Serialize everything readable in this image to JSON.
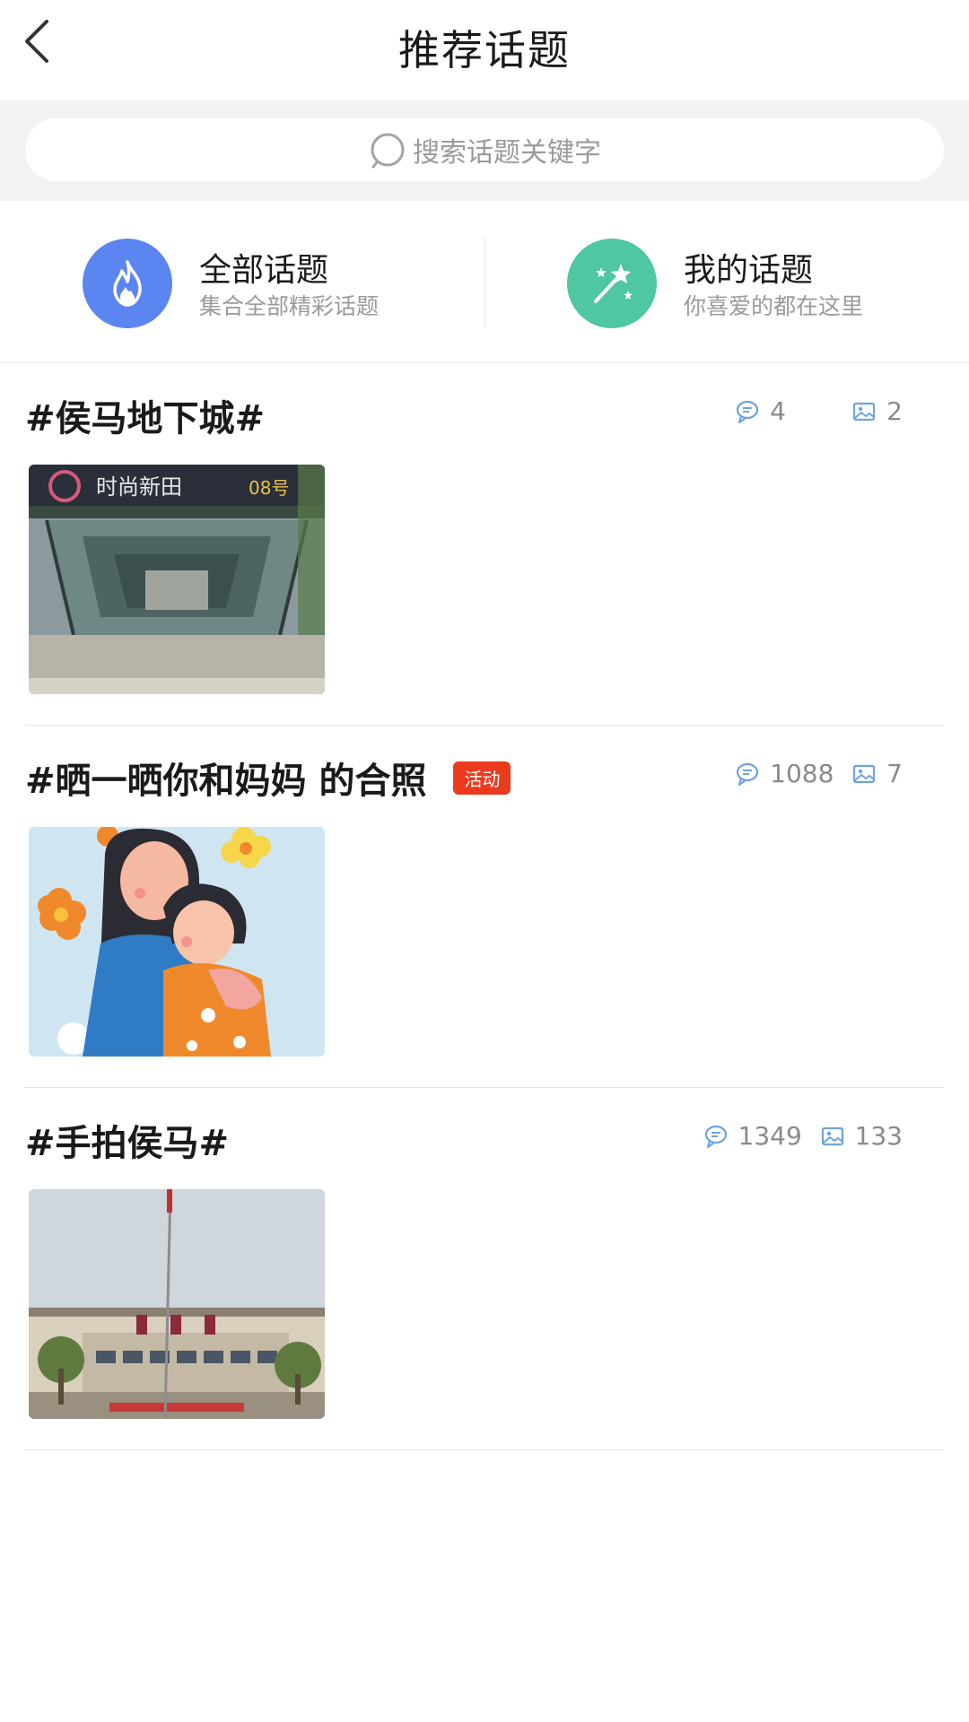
{
  "header": {
    "title": "推荐话题"
  },
  "search": {
    "placeholder": "搜索话题关键字"
  },
  "quick_links": [
    {
      "title": "全部话题",
      "subtitle": "集合全部精彩话题",
      "icon": "fire-icon",
      "color": "#5b86f1"
    },
    {
      "title": "我的话题",
      "subtitle": "你喜爱的都在这里",
      "icon": "magic-wand-icon",
      "color": "#4fc6a4"
    }
  ],
  "topics": [
    {
      "title": "#侯马地下城#",
      "badge": "",
      "comments": "4",
      "images": "2",
      "thumb": "underground-mall-entrance-photo"
    },
    {
      "title": "#晒一晒你和妈妈 的合照",
      "badge": "活动",
      "comments": "1088",
      "images": "7",
      "thumb": "mother-daughter-illustration"
    },
    {
      "title": "#手拍侯马#",
      "badge": "",
      "comments": "1349",
      "images": "133",
      "thumb": "houma-station-photo"
    }
  ],
  "colors": {
    "accent_blue": "#5b86f1",
    "accent_green": "#4fc6a4",
    "badge_red": "#ea3b1f",
    "stat_icon": "#6fa3e0"
  }
}
